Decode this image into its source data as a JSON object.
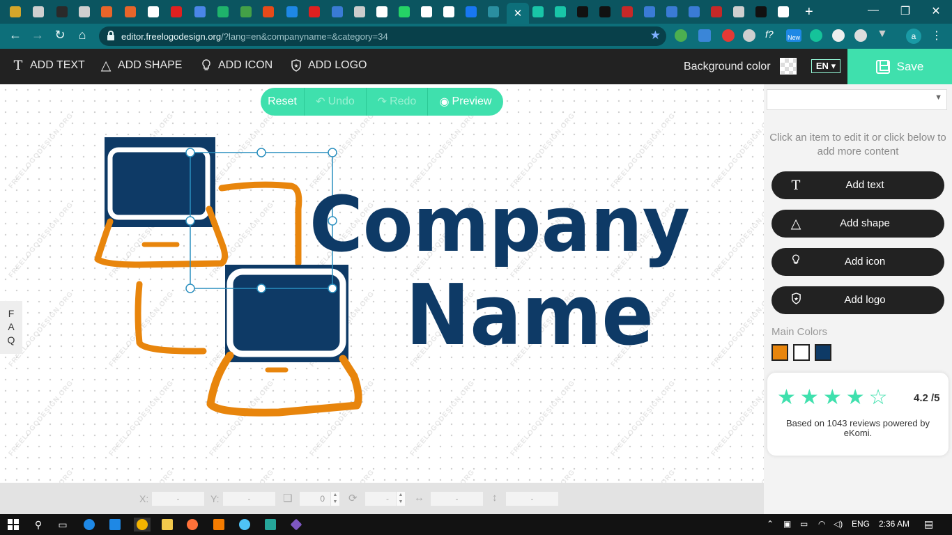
{
  "browser": {
    "url_host": "editor.freelogodesign.org",
    "url_rest": "/?lang=en&companyname=&category=34",
    "profile_initial": "a",
    "new_badge": "New",
    "tab_favicons": [
      "#d4a62a",
      "#cfcfcf",
      "#2a2a2a",
      "#cfcfcf",
      "#e8652a",
      "#e8652a",
      "#ffffff",
      "#e02020",
      "#4a86e8",
      "#1fb36b",
      "#43a047",
      "#e64a19",
      "#1e88e5",
      "#e02020",
      "#3a7bd5",
      "#cccccc",
      "#ffffff",
      "#25d366",
      "#ffffff",
      "#ffffff",
      "#1877f2",
      "#2a8fa0",
      "#19c5a8",
      "#19c5a8",
      "#111111",
      "#111111",
      "#c62828",
      "#3a7bd5",
      "#3a7bd5",
      "#3a7bd5",
      "#c62828",
      "#cfcfcf",
      "#111111",
      "#ffffff"
    ]
  },
  "toolbar": {
    "add_text": "ADD TEXT",
    "add_shape": "ADD SHAPE",
    "add_icon": "ADD ICON",
    "add_logo": "ADD LOGO",
    "background_color_label": "Background color",
    "language": "EN",
    "save_label": "Save"
  },
  "canvas": {
    "reset": "Reset",
    "undo": "Undo",
    "redo": "Redo",
    "preview": "Preview",
    "company_line1": "Company",
    "company_line2": "Name",
    "watermark": "FREELOGODESIGN.ORG",
    "faq": [
      "F",
      "A",
      "Q"
    ]
  },
  "properties": {
    "x_label": "X:",
    "y_label": "Y:",
    "x_value": "-",
    "y_value": "-",
    "layer_value": "0",
    "rotation_value": "-",
    "width_value": "-",
    "height_value": "-"
  },
  "panel": {
    "hint": "Click an item to edit it or click below to add more content",
    "add_text": "Add text",
    "add_shape": "Add shape",
    "add_icon": "Add icon",
    "add_logo": "Add logo",
    "main_colors_label": "Main Colors",
    "main_colors": [
      "#e8850c",
      "#ffffff",
      "#0e3a66"
    ],
    "rating_value": 4.2,
    "rating_score": "4.2 /5",
    "rating_text": "Based on 1043 reviews powered by eKomi."
  },
  "taskbar": {
    "language": "ENG",
    "time": "2:36 AM"
  }
}
